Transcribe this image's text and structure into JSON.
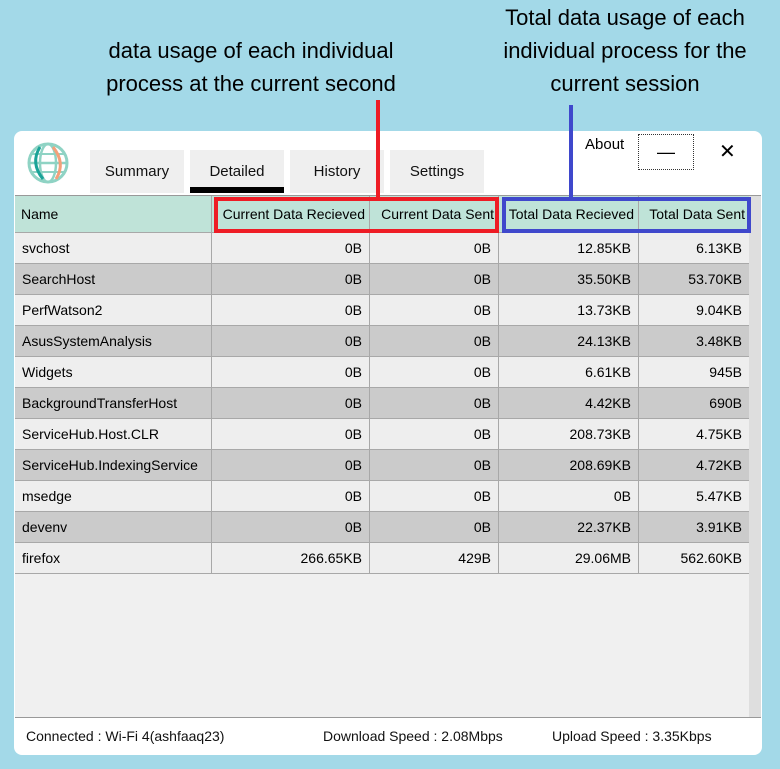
{
  "annotations": {
    "left": [
      "data usage of each individual",
      "process at the current second"
    ],
    "right": [
      "Total data usage of each",
      "individual process for the",
      "current session"
    ],
    "left_color": "#ee1c25",
    "right_color": "#3f48cc"
  },
  "window": {
    "about": "About",
    "minimize": "—",
    "close": "✕"
  },
  "tabs": [
    {
      "label": "Summary"
    },
    {
      "label": "Detailed",
      "active": true
    },
    {
      "label": "History"
    },
    {
      "label": "Settings"
    }
  ],
  "table": {
    "headers": [
      "Name",
      "Current Data Recieved",
      "Current Data Sent",
      "Total Data Recieved",
      "Total Data Sent"
    ],
    "rows": [
      [
        "svchost",
        "0B",
        "0B",
        "12.85KB",
        "6.13KB"
      ],
      [
        "SearchHost",
        "0B",
        "0B",
        "35.50KB",
        "53.70KB"
      ],
      [
        "PerfWatson2",
        "0B",
        "0B",
        "13.73KB",
        "9.04KB"
      ],
      [
        "AsusSystemAnalysis",
        "0B",
        "0B",
        "24.13KB",
        "3.48KB"
      ],
      [
        "Widgets",
        "0B",
        "0B",
        "6.61KB",
        "945B"
      ],
      [
        "BackgroundTransferHost",
        "0B",
        "0B",
        "4.42KB",
        "690B"
      ],
      [
        "ServiceHub.Host.CLR",
        "0B",
        "0B",
        "208.73KB",
        "4.75KB"
      ],
      [
        "ServiceHub.IndexingService",
        "0B",
        "0B",
        "208.69KB",
        "4.72KB"
      ],
      [
        "msedge",
        "0B",
        "0B",
        "0B",
        "5.47KB"
      ],
      [
        "devenv",
        "0B",
        "0B",
        "22.37KB",
        "3.91KB"
      ],
      [
        "firefox",
        "266.65KB",
        "429B",
        "29.06MB",
        "562.60KB"
      ]
    ]
  },
  "status": {
    "connected": "Connected : Wi-Fi 4(ashfaaq23)",
    "download": "Download Speed : 2.08Mbps",
    "upload": "Upload Speed : 3.35Kbps"
  }
}
